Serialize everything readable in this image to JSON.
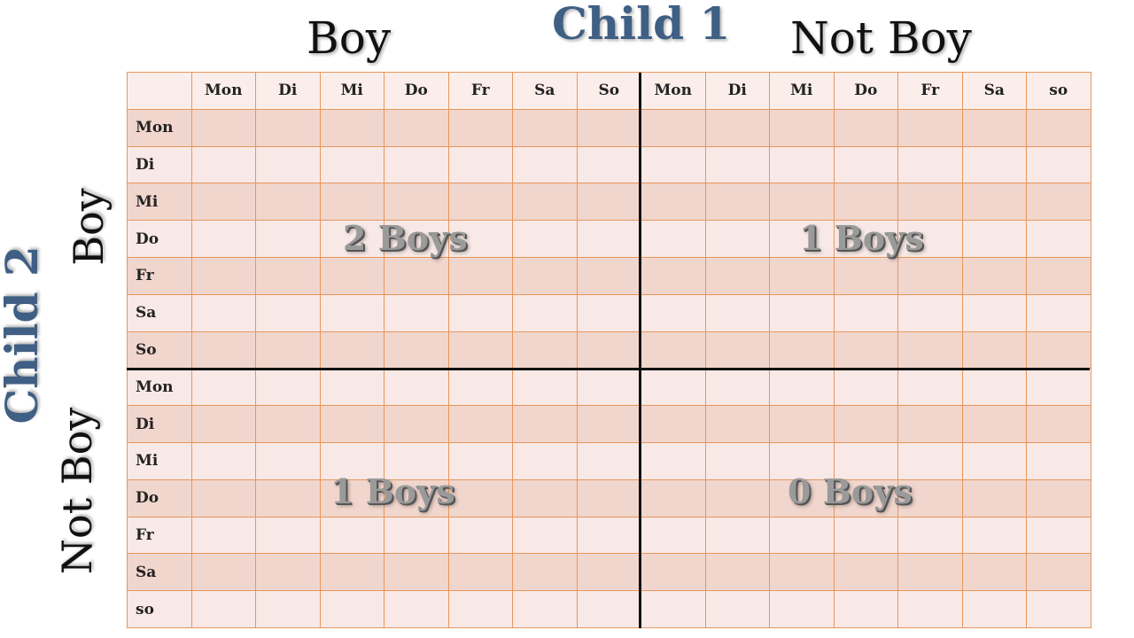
{
  "child1_label": "Child 1",
  "child2_label": "Child 2",
  "columns": {
    "boy_label": "Boy",
    "not_boy_label": "Not Boy",
    "days": [
      "Mon",
      "Di",
      "Mi",
      "Do",
      "Fr",
      "Sa",
      "So",
      "Mon",
      "Di",
      "Mi",
      "Do",
      "Fr",
      "Sa",
      "so"
    ]
  },
  "rows": {
    "boy_label": "Boy",
    "not_boy_label": "Not Boy",
    "days": [
      "Mon",
      "Di",
      "Mi",
      "Do",
      "Fr",
      "Sa",
      "So",
      "Mon",
      "Di",
      "Mi",
      "Do",
      "Fr",
      "Sa",
      "so"
    ]
  },
  "quadrants": {
    "boy_boy": "2 Boys",
    "boy_notboy": "1 Boys",
    "notboy_boy": "1 Boys",
    "notboy_notboy": "0 Boys"
  },
  "colors": {
    "title_blue": "#3f5f84",
    "cell_dark": "#f1d6cd",
    "cell_light": "#f8e9e6",
    "grid_line": "#e8965c"
  }
}
